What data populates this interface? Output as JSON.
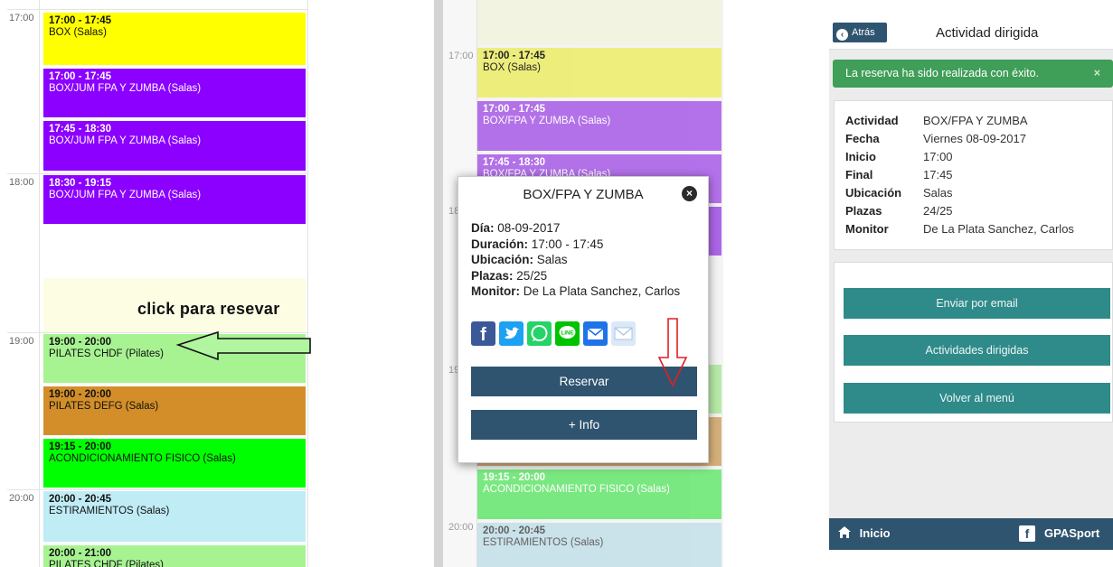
{
  "colors": {
    "yellow": "#ffff00",
    "purple": "#8b00ff",
    "green_light": "#a7f392",
    "brown": "#d38e29",
    "green": "#00ff00",
    "cyan": "#c0ecf6",
    "navy": "#2f5470",
    "teal": "#2f8a8a",
    "success": "#3f9e57"
  },
  "calendar": {
    "times": [
      "17:00",
      "18:00",
      "19:00",
      "20:00"
    ],
    "instruction": "click para resevar",
    "events": [
      {
        "time": "17:00 - 17:45",
        "name": "BOX (Salas)"
      },
      {
        "time": "17:00 - 17:45",
        "name": "BOX/JUM FPA Y ZUMBA (Salas)"
      },
      {
        "time": "17:45 - 18:30",
        "name": "BOX/JUM FPA Y ZUMBA (Salas)"
      },
      {
        "time": "18:30 - 19:15",
        "name": "BOX/JUM FPA Y ZUMBA (Salas)"
      },
      {
        "time": "19:00 - 20:00",
        "name": "PILATES CHDF (Pilates)"
      },
      {
        "time": "19:00 - 20:00",
        "name": "PILATES DEFG (Salas)"
      },
      {
        "time": "19:15 - 20:00",
        "name": "ACONDICIONAMIENTO FISICO (Salas)"
      },
      {
        "time": "20:00 - 20:45",
        "name": "ESTIRAMIENTOS (Salas)"
      },
      {
        "time": "20:00 - 21:00",
        "name": "PILATES CHDF (Pilates)"
      }
    ]
  },
  "calendar2": {
    "times": [
      "17:00",
      "18",
      "19",
      "20:00"
    ],
    "events": [
      {
        "time": "17:00 - 17:45",
        "name": "BOX (Salas)"
      },
      {
        "time": "17:00 - 17:45",
        "name": "BOX/FPA Y ZUMBA (Salas)"
      },
      {
        "time": "17:45 - 18:30",
        "name": "BOX/FPA Y ZUMBA (Salas)"
      },
      {
        "time": "19:15 - 20:00",
        "name": "ACONDICIONAMIENTO FISICO (Salas)"
      },
      {
        "time": "20:00 - 20:45",
        "name": "ESTIRAMIENTOS (Salas)"
      }
    ]
  },
  "popup": {
    "title": "BOX/FPA Y ZUMBA",
    "dia_label": "Día:",
    "dia": "08-09-2017",
    "duracion_label": "Duración:",
    "duracion": "17:00 - 17:45",
    "ubicacion_label": "Ubicación:",
    "ubicacion": "Salas",
    "plazas_label": "Plazas:",
    "plazas": "25/25",
    "monitor_label": "Monitor:",
    "monitor": "De La Plata Sanchez, Carlos",
    "share_icons": [
      "facebook-icon",
      "twitter-icon",
      "whatsapp-icon",
      "line-icon",
      "email-icon",
      "gmail-icon"
    ],
    "reservar": "Reservar",
    "info": "+ Info"
  },
  "mobile": {
    "back": "Atrás",
    "title": "Actividad dirigida",
    "success": "La reserva ha sido realizada con éxito.",
    "success_close": "×",
    "details": [
      {
        "key": "Actividad",
        "value": "BOX/FPA Y ZUMBA"
      },
      {
        "key": "Fecha",
        "value": "Viernes 08-09-2017"
      },
      {
        "key": "Inicio",
        "value": "17:00"
      },
      {
        "key": "Final",
        "value": "17:45"
      },
      {
        "key": "Ubicación",
        "value": "Salas"
      },
      {
        "key": "Plazas",
        "value": "24/25"
      },
      {
        "key": "Monitor",
        "value": "De La Plata Sanchez, Carlos"
      }
    ],
    "buttons": [
      "Enviar por email",
      "Actividades dirigidas",
      "Volver al menú"
    ],
    "footer_home": "Inicio",
    "footer_brand": "GPASport"
  }
}
